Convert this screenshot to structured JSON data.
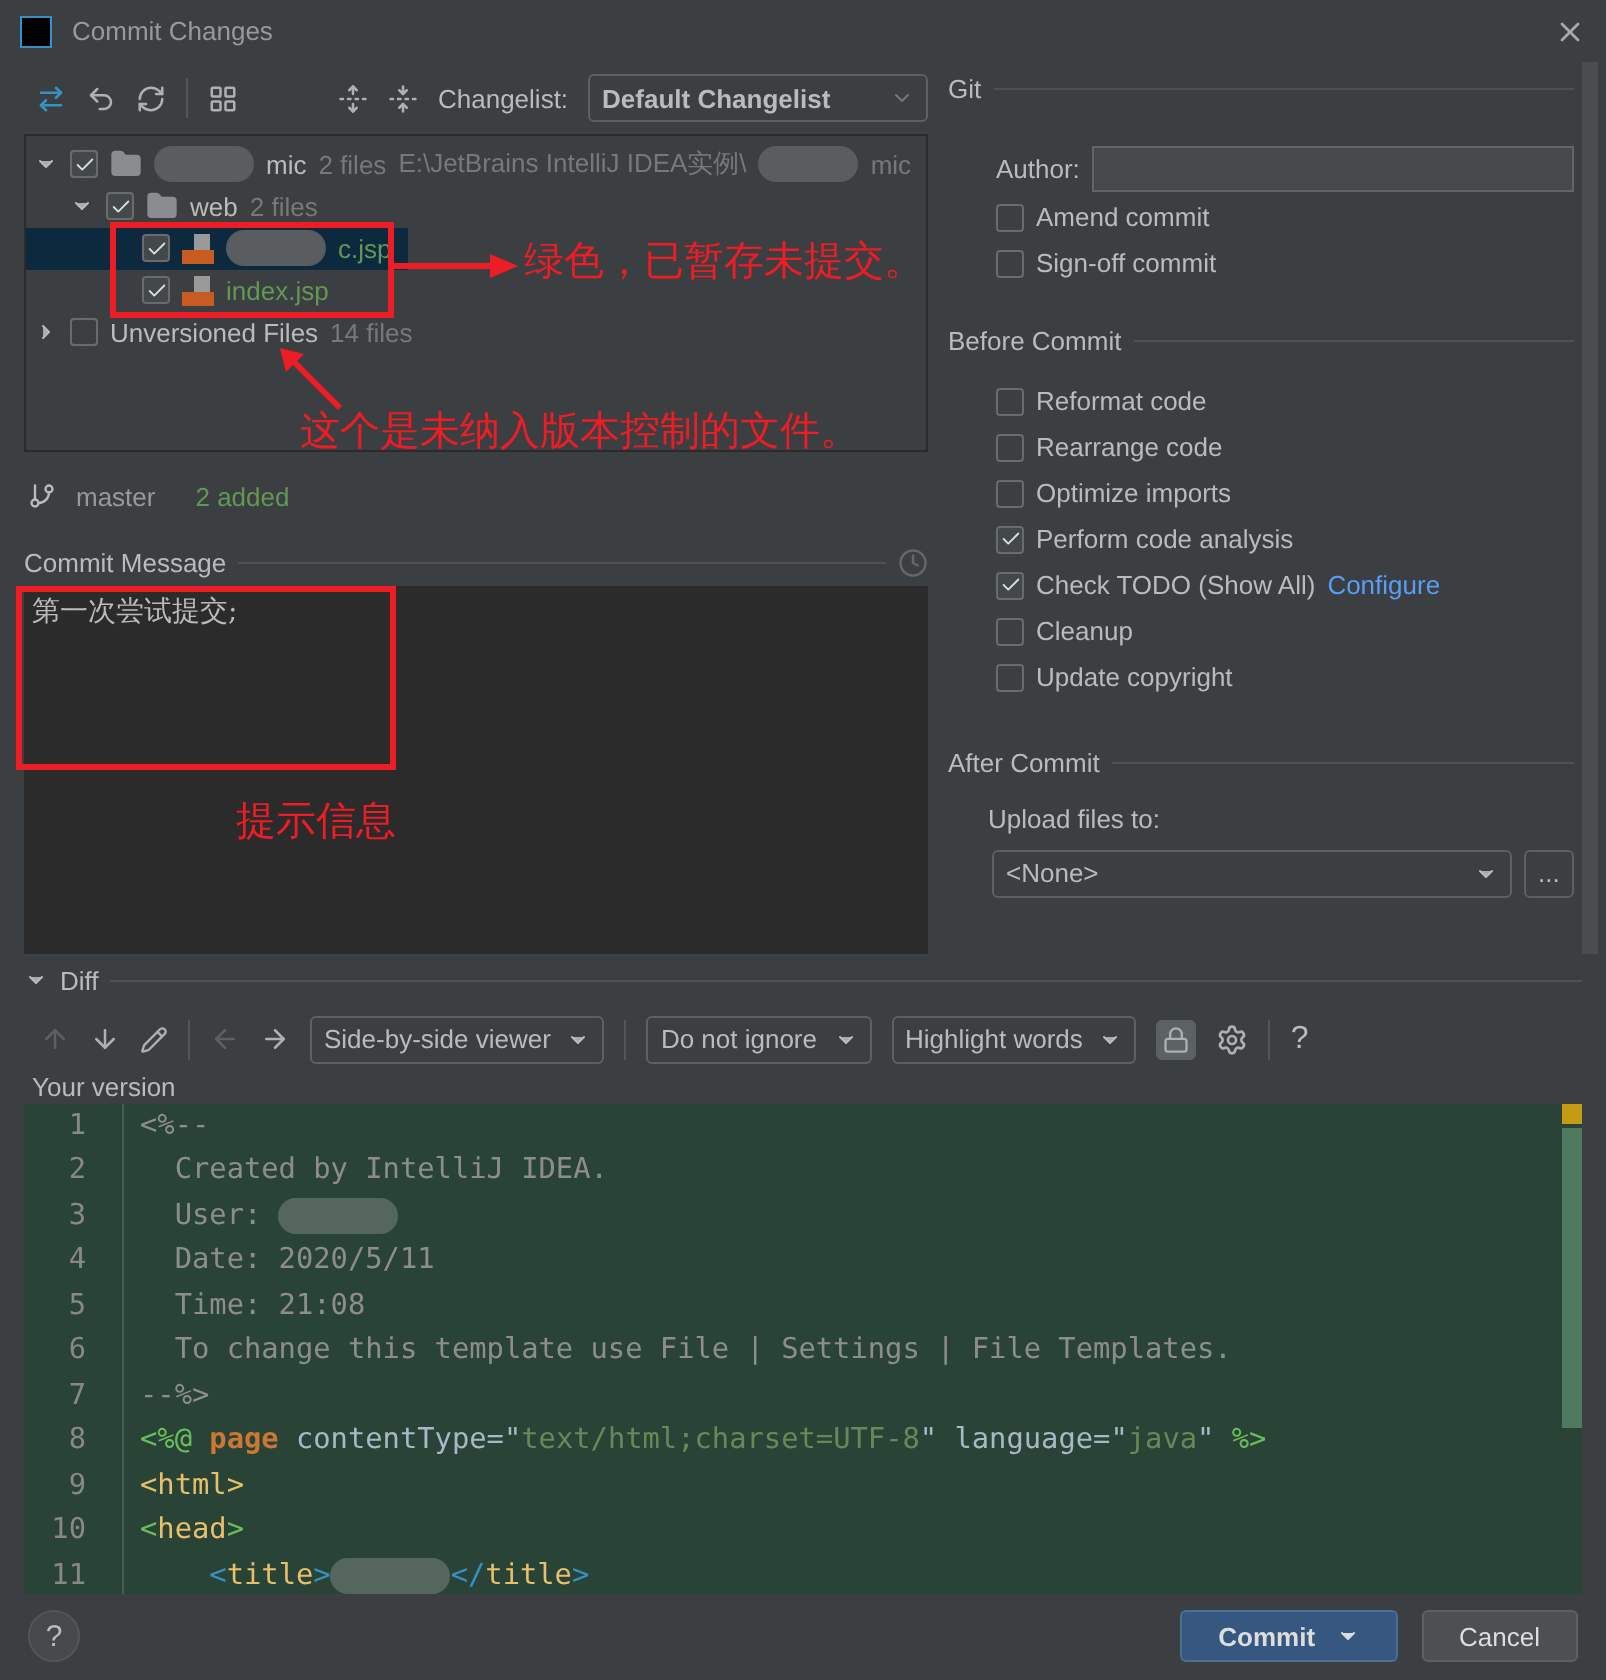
{
  "window": {
    "title": "Commit Changes"
  },
  "changelist": {
    "label": "Changelist:",
    "value": "Default Changelist"
  },
  "tree": [
    {
      "kind": "module",
      "name": "mic",
      "redacted": true,
      "count": "2 files",
      "path": "E:\\JetBrains IntelliJ IDEA实例\\",
      "path_end": "mic",
      "checked": true,
      "expanded": true,
      "selected": false,
      "children": [
        {
          "kind": "folder",
          "name": "web",
          "redacted": false,
          "count": "2 files",
          "checked": true,
          "expanded": true,
          "selected": false,
          "children": [
            {
              "kind": "jsp",
              "name": "c.jsp",
              "redacted": true,
              "checked": true,
              "selected": true
            },
            {
              "kind": "jsp",
              "name": "index.jsp",
              "redacted": false,
              "checked": true,
              "selected": false
            }
          ]
        }
      ]
    },
    {
      "kind": "group",
      "name": "Unversioned Files",
      "redacted": false,
      "count": "14 files",
      "checked": false,
      "expanded": false,
      "selected": false
    }
  ],
  "branch": {
    "name": "master",
    "status": "2 added"
  },
  "commit_message": {
    "label": "Commit Message",
    "value": "第一次尝试提交;"
  },
  "git": {
    "title": "Git",
    "author_label": "Author:",
    "options": [
      {
        "label": "Amend commit",
        "checked": false
      },
      {
        "label": "Sign-off commit",
        "checked": false
      }
    ]
  },
  "before_commit": {
    "title": "Before Commit",
    "options": [
      {
        "label": "Reformat code",
        "checked": false
      },
      {
        "label": "Rearrange code",
        "checked": false
      },
      {
        "label": "Optimize imports",
        "checked": false
      },
      {
        "label": "Perform code analysis",
        "checked": true
      },
      {
        "label": "Check TODO (Show All)",
        "link": "Configure",
        "checked": true
      },
      {
        "label": "Cleanup",
        "checked": false
      },
      {
        "label": "Update copyright",
        "checked": false
      }
    ]
  },
  "after_commit": {
    "title": "After Commit",
    "upload_label": "Upload files to:",
    "server": "<None>",
    "browse": "..."
  },
  "diff": {
    "title": "Diff",
    "expanded": true,
    "viewer": "Side-by-side viewer",
    "ignore": "Do not ignore",
    "highlight": "Highlight words",
    "locked": true,
    "help": "?",
    "side_label": "Your version",
    "lines": [
      {
        "number": "1",
        "tokens": [
          {
            "kind": "comment",
            "text": "<%--"
          }
        ]
      },
      {
        "number": "2",
        "tokens": [
          {
            "kind": "comment",
            "text": "  Created by IntelliJ IDEA."
          }
        ]
      },
      {
        "number": "3",
        "tokens": [
          {
            "kind": "comment",
            "text": "  User: "
          },
          {
            "kind": "redacted"
          }
        ]
      },
      {
        "number": "4",
        "tokens": [
          {
            "kind": "comment",
            "text": "  Date: 2020/5/11"
          }
        ]
      },
      {
        "number": "5",
        "tokens": [
          {
            "kind": "comment",
            "text": "  Time: 21:08"
          }
        ]
      },
      {
        "number": "6",
        "tokens": [
          {
            "kind": "comment",
            "text": "  To change this template use File | Settings | File Templates."
          }
        ]
      },
      {
        "number": "7",
        "tokens": [
          {
            "kind": "comment",
            "text": "--%>"
          }
        ]
      },
      {
        "number": "8",
        "tokens": [
          {
            "kind": "directive",
            "text": "<%@ "
          },
          {
            "kind": "keyword",
            "text": "page "
          },
          {
            "kind": "plain",
            "text": "contentType=\""
          },
          {
            "kind": "string",
            "text": "text/html;charset=UTF-8"
          },
          {
            "kind": "plain",
            "text": "\" language=\""
          },
          {
            "kind": "string",
            "text": "java"
          },
          {
            "kind": "plain",
            "text": "\" "
          },
          {
            "kind": "directive",
            "text": "%>"
          }
        ]
      },
      {
        "number": "9",
        "tokens": [
          {
            "kind": "tag",
            "text": "<html>"
          }
        ]
      },
      {
        "number": "10",
        "tokens": [
          {
            "kind": "bracket_green",
            "text": "<"
          },
          {
            "kind": "tag",
            "text": "head"
          },
          {
            "kind": "bracket_green",
            "text": ">"
          }
        ]
      },
      {
        "number": "11",
        "tokens": [
          {
            "kind": "bracket_blue",
            "text": "    <"
          },
          {
            "kind": "tag",
            "text": "title"
          },
          {
            "kind": "bracket_blue",
            "text": ">"
          },
          {
            "kind": "redacted"
          },
          {
            "kind": "bracket_blue",
            "text": "</"
          },
          {
            "kind": "tag",
            "text": "title"
          },
          {
            "kind": "bracket_blue",
            "text": ">"
          }
        ]
      }
    ]
  },
  "buttons": {
    "help": "?",
    "commit": "Commit",
    "cancel": "Cancel"
  },
  "annotations": {
    "staged_note": "绿色，已暂存未提交。",
    "unversioned_note": "这个是未纳入版本控制的文件。",
    "message_note": "提示信息"
  }
}
